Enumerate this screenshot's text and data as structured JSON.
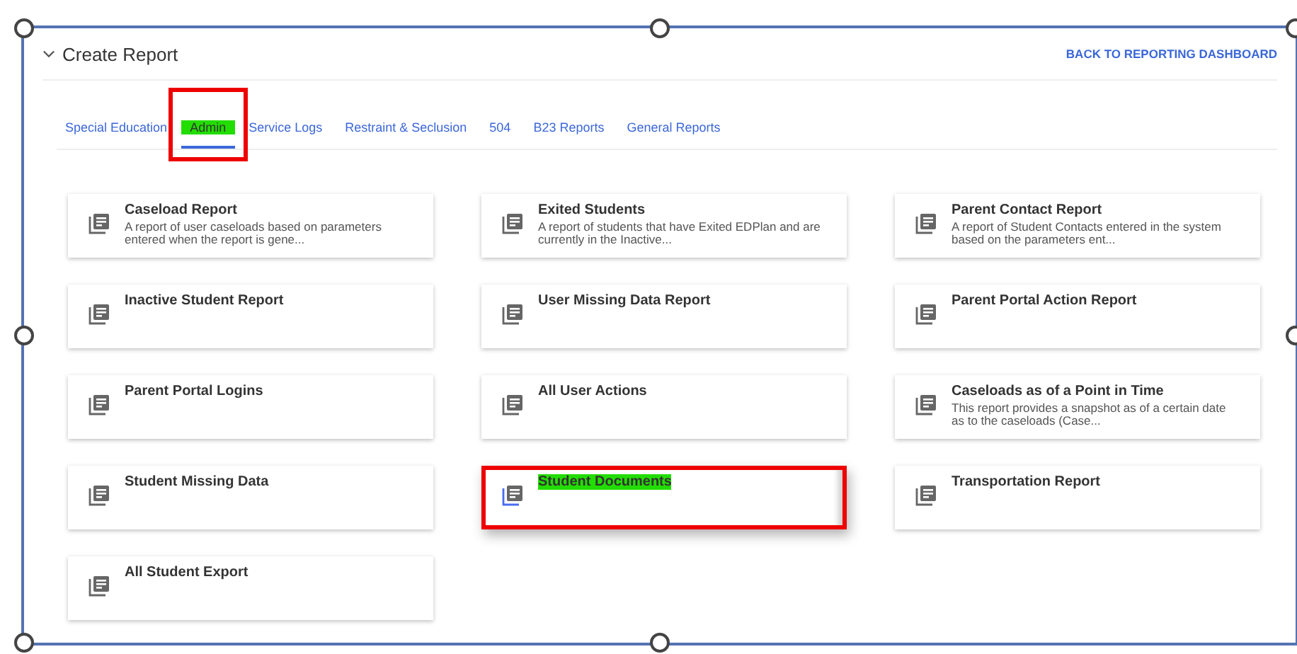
{
  "header": {
    "title": "Create Report",
    "back_link": "BACK TO REPORTING DASHBOARD"
  },
  "tabs": [
    {
      "label": "Special Education",
      "selected": false,
      "highlighted": false
    },
    {
      "label": "Admin",
      "selected": true,
      "highlighted": true
    },
    {
      "label": "Service Logs",
      "selected": false,
      "highlighted": false
    },
    {
      "label": "Restraint & Seclusion",
      "selected": false,
      "highlighted": false
    },
    {
      "label": "504",
      "selected": false,
      "highlighted": false
    },
    {
      "label": "B23 Reports",
      "selected": false,
      "highlighted": false
    },
    {
      "label": "General Reports",
      "selected": false,
      "highlighted": false
    }
  ],
  "reports": [
    {
      "title": "Caseload Report",
      "description": "A report of user caseloads based on parameters entered when the report is gene...",
      "highlighted": false
    },
    {
      "title": "Exited Students",
      "description": "A report of students that have Exited EDPlan and are currently in the Inactive...",
      "highlighted": false
    },
    {
      "title": "Parent Contact Report",
      "description": "A report of Student Contacts entered in the system based on the parameters ent...",
      "highlighted": false
    },
    {
      "title": "Inactive Student Report",
      "highlighted": false
    },
    {
      "title": "User Missing Data Report",
      "highlighted": false
    },
    {
      "title": "Parent Portal Action Report",
      "highlighted": false
    },
    {
      "title": "Parent Portal Logins",
      "highlighted": false
    },
    {
      "title": "All User Actions",
      "highlighted": false
    },
    {
      "title": "Caseloads as of a Point in Time",
      "description": "This report provides a snapshot as of a certain date as to the caseloads (Case...",
      "highlighted": false
    },
    {
      "title": "Student Missing Data",
      "highlighted": false
    },
    {
      "title": "Student Documents",
      "highlighted": true
    },
    {
      "title": "Transportation Report",
      "highlighted": false
    },
    {
      "title": "All Student Export",
      "highlighted": false
    }
  ]
}
